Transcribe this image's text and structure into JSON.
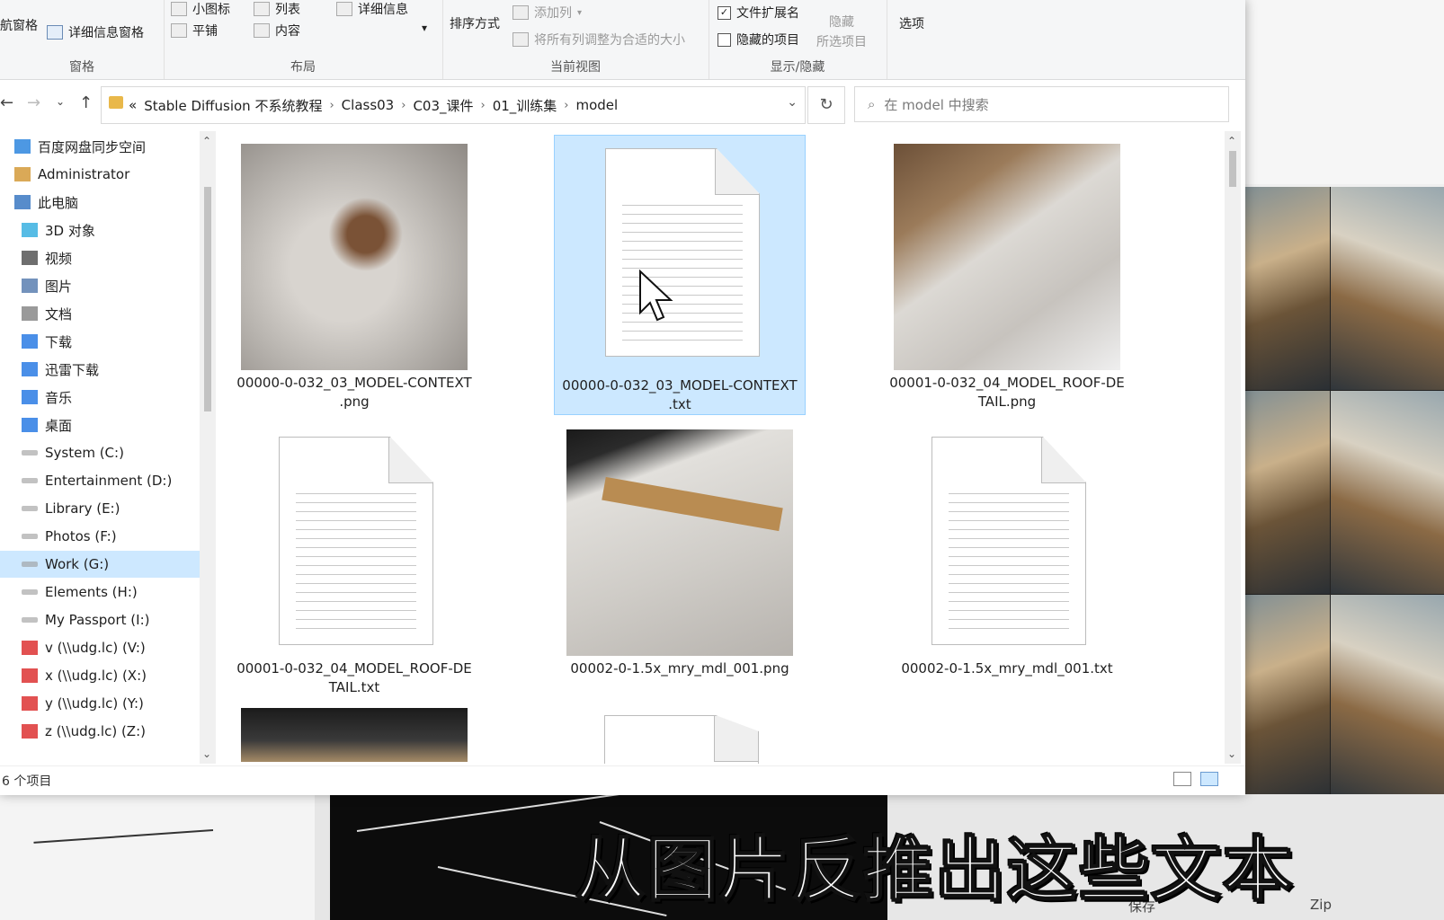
{
  "ribbon": {
    "groups": {
      "panes": "窗格",
      "layout": "布局",
      "current_view": "当前视图",
      "show_hide": "显示/隐藏"
    },
    "nav_pane_label": "航窗格",
    "details_pane": "详细信息窗格",
    "small_icons": "小图标",
    "list": "列表",
    "details": "详细信息",
    "tiles": "平铺",
    "content": "内容",
    "sort_by": "排序方式",
    "add_columns": "添加列",
    "size_all_columns": "将所有列调整为合适的大小",
    "file_name_extensions": "文件扩展名",
    "file_name_extensions_checked": true,
    "hidden_items": "隐藏的项目",
    "hidden_items_checked": false,
    "hide_selected_line1": "隐藏",
    "hide_selected_line2": "所选项目",
    "options": "选项"
  },
  "address": {
    "overflow": "«",
    "crumbs": [
      "Stable Diffusion 不系统教程",
      "Class03",
      "C03_课件",
      "01_训练集",
      "model"
    ],
    "search_placeholder": "在 model 中搜索"
  },
  "nav": {
    "items": [
      {
        "label": "百度网盘同步空间",
        "icon": "cloud-sync-icon"
      },
      {
        "label": "Administrator",
        "icon": "user-icon"
      },
      {
        "label": "此电脑",
        "icon": "computer-icon"
      },
      {
        "label": "3D 对象",
        "icon": "3d-objects-icon"
      },
      {
        "label": "视频",
        "icon": "videos-icon"
      },
      {
        "label": "图片",
        "icon": "pictures-icon"
      },
      {
        "label": "文档",
        "icon": "documents-icon"
      },
      {
        "label": "下载",
        "icon": "downloads-icon"
      },
      {
        "label": "迅雷下载",
        "icon": "thunder-download-icon"
      },
      {
        "label": "音乐",
        "icon": "music-icon"
      },
      {
        "label": "桌面",
        "icon": "desktop-icon"
      },
      {
        "label": "System (C:)",
        "icon": "drive-icon"
      },
      {
        "label": "Entertainment (D:)",
        "icon": "drive-icon"
      },
      {
        "label": "Library (E:)",
        "icon": "drive-icon"
      },
      {
        "label": "Photos (F:)",
        "icon": "drive-icon"
      },
      {
        "label": "Work (G:)",
        "icon": "drive-icon"
      },
      {
        "label": "Elements (H:)",
        "icon": "drive-icon"
      },
      {
        "label": "My Passport (I:)",
        "icon": "drive-icon"
      },
      {
        "label": "v (\\\\udg.lc) (V:)",
        "icon": "network-drive-disconnected-icon"
      },
      {
        "label": "x (\\\\udg.lc) (X:)",
        "icon": "network-drive-disconnected-icon"
      },
      {
        "label": "y (\\\\udg.lc) (Y:)",
        "icon": "network-drive-disconnected-icon"
      },
      {
        "label": "z (\\\\udg.lc) (Z:)",
        "icon": "network-drive-disconnected-icon"
      }
    ],
    "selected": "Work (G:)"
  },
  "files": [
    {
      "line1": "00000-0-032_03_MODEL-CONTEXT",
      "line2": ".png",
      "kind": "image",
      "selected": false
    },
    {
      "line1": "00000-0-032_03_MODEL-CONTEXT",
      "line2": ".txt",
      "kind": "text",
      "selected": true
    },
    {
      "line1": "00001-0-032_04_MODEL_ROOF-DE",
      "line2": "TAIL.png",
      "kind": "image",
      "selected": false
    },
    {
      "line1": "00001-0-032_04_MODEL_ROOF-DE",
      "line2": "TAIL.txt",
      "kind": "text",
      "selected": false
    },
    {
      "line1": "00002-0-1.5x_mry_mdl_001.png",
      "line2": "",
      "kind": "image",
      "selected": false
    },
    {
      "line1": "00002-0-1.5x_mry_mdl_001.txt",
      "line2": "",
      "kind": "text",
      "selected": false
    }
  ],
  "status": {
    "item_count": "6 个项目"
  },
  "overlay": {
    "caption": "从图片反推出这些文本",
    "save_label": "保存",
    "zip_label": "Zip"
  }
}
